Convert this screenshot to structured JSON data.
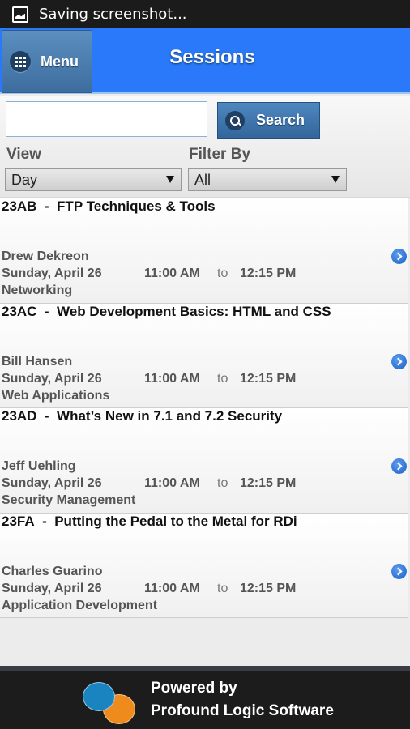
{
  "status_bar": {
    "icon": "image-icon",
    "text": "Saving screenshot..."
  },
  "header": {
    "menu_label": "Menu",
    "title": "Sessions"
  },
  "search": {
    "value": "",
    "placeholder": "",
    "button_label": "Search"
  },
  "filters": {
    "view_label": "View",
    "view_selected": "Day",
    "filter_label": "Filter By",
    "filter_selected": "All"
  },
  "sessions": [
    {
      "code": "23AB",
      "separator": "-",
      "title": "FTP Techniques & Tools",
      "speaker": "Drew Dekreon",
      "date": "Sunday, April 26",
      "start": "11:00 AM",
      "to": "to",
      "end": "12:15 PM",
      "track": "Networking"
    },
    {
      "code": "23AC",
      "separator": "-",
      "title": "Web Development Basics: HTML and CSS",
      "speaker": "Bill Hansen",
      "date": "Sunday, April 26",
      "start": "11:00 AM",
      "to": "to",
      "end": "12:15 PM",
      "track": "Web Applications"
    },
    {
      "code": "23AD",
      "separator": "-",
      "title": "What’s New in 7.1 and 7.2 Security",
      "speaker": "Jeff Uehling",
      "date": "Sunday, April 26",
      "start": "11:00 AM",
      "to": "to",
      "end": "12:15 PM",
      "track": "Security Management"
    },
    {
      "code": "23FA",
      "separator": "-",
      "title": "Putting the Pedal to the Metal for RDi",
      "speaker": "Charles Guarino",
      "date": "Sunday, April 26",
      "start": "11:00 AM",
      "to": "to",
      "end": "12:15 PM",
      "track": "Application Development"
    }
  ],
  "footer": {
    "line1": "Powered by",
    "line2": "Profound Logic Software"
  }
}
